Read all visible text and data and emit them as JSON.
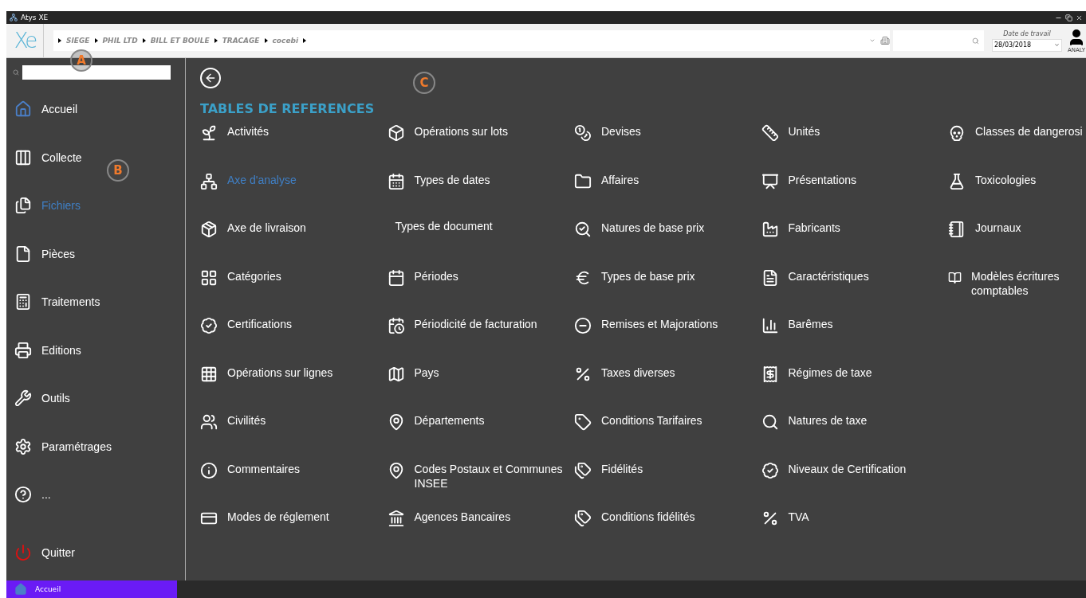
{
  "window": {
    "title": "Atys XE"
  },
  "toolbar": {
    "logo": "Xe",
    "breadcrumbs": [
      "SIEGE",
      "PHIL LTD",
      "BILL ET BOULE",
      "TRACAGE",
      "cocebi"
    ],
    "date_label": "Date de travail",
    "date_value": "28/03/2018",
    "user": "ANALY"
  },
  "sidebar": {
    "items": [
      {
        "label": "Accueil",
        "selected": false
      },
      {
        "label": "Collecte",
        "selected": false
      },
      {
        "label": "Fichiers",
        "selected": true
      },
      {
        "label": "Pièces",
        "selected": false
      },
      {
        "label": "Traitements",
        "selected": false
      },
      {
        "label": "Editions",
        "selected": false
      },
      {
        "label": "Outils",
        "selected": false
      },
      {
        "label": "Paramétrages",
        "selected": false
      },
      {
        "label": "...",
        "selected": false
      },
      {
        "label": "Quitter",
        "selected": false
      }
    ]
  },
  "main": {
    "title": "TABLES DE REFERENCES",
    "items": [
      {
        "label": "Activités",
        "selected": false,
        "kind": "icon"
      },
      {
        "label": "Axe d'analyse",
        "selected": true,
        "kind": "icon"
      },
      {
        "label": "Axe de livraison",
        "selected": false,
        "kind": "icon"
      },
      {
        "label": "Catégories",
        "selected": false,
        "kind": "icon"
      },
      {
        "label": "Certifications",
        "selected": false,
        "kind": "icon"
      },
      {
        "label": "Opérations sur lignes",
        "selected": false,
        "kind": "icon"
      },
      {
        "label": "Civilités",
        "selected": false,
        "kind": "icon"
      },
      {
        "label": "Commentaires",
        "selected": false,
        "kind": "icon"
      },
      {
        "label": "Modes de réglement",
        "selected": false,
        "kind": "icon"
      },
      {
        "label": "Opérations sur lots",
        "selected": false,
        "kind": "icon"
      },
      {
        "label": "Types de dates",
        "selected": false,
        "kind": "icon"
      },
      {
        "label": "Types de document",
        "selected": false,
        "kind": "plain"
      },
      {
        "label": "Périodes",
        "selected": false,
        "kind": "icon"
      },
      {
        "label": "Périodicité de facturation",
        "selected": false,
        "kind": "icon"
      },
      {
        "label": "Pays",
        "selected": false,
        "kind": "icon"
      },
      {
        "label": "Départements",
        "selected": false,
        "kind": "icon"
      },
      {
        "label": "Codes Postaux et Communes INSEE",
        "selected": false,
        "kind": "icon"
      },
      {
        "label": "Agences Bancaires",
        "selected": false,
        "kind": "icon"
      },
      {
        "label": "Devises",
        "selected": false,
        "kind": "icon"
      },
      {
        "label": "Affaires",
        "selected": false,
        "kind": "icon"
      },
      {
        "label": "Natures de base prix",
        "selected": false,
        "kind": "icon"
      },
      {
        "label": "Types de base prix",
        "selected": false,
        "kind": "icon"
      },
      {
        "label": "Remises et Majorations",
        "selected": false,
        "kind": "icon"
      },
      {
        "label": "Taxes diverses",
        "selected": false,
        "kind": "icon"
      },
      {
        "label": "Conditions Tarifaires",
        "selected": false,
        "kind": "icon"
      },
      {
        "label": "Fidélités",
        "selected": false,
        "kind": "icon"
      },
      {
        "label": "Conditions fidélités",
        "selected": false,
        "kind": "icon"
      },
      {
        "label": "Unités",
        "selected": false,
        "kind": "icon"
      },
      {
        "label": "Présentations",
        "selected": false,
        "kind": "icon"
      },
      {
        "label": "Fabricants",
        "selected": false,
        "kind": "icon"
      },
      {
        "label": "Caractéristiques",
        "selected": false,
        "kind": "icon"
      },
      {
        "label": "Barêmes",
        "selected": false,
        "kind": "icon"
      },
      {
        "label": "Régimes de taxe",
        "selected": false,
        "kind": "icon"
      },
      {
        "label": "Natures de taxe",
        "selected": false,
        "kind": "icon"
      },
      {
        "label": "Niveaux de Certification",
        "selected": false,
        "kind": "icon"
      },
      {
        "label": "TVA",
        "selected": false,
        "kind": "icon"
      },
      {
        "label": "Classes de dangerosi",
        "selected": false,
        "kind": "icon"
      },
      {
        "label": "Toxicologies",
        "selected": false,
        "kind": "icon"
      },
      {
        "label": "Journaux",
        "selected": false,
        "kind": "icon"
      },
      {
        "label": "Modèles écritures comptables",
        "selected": false,
        "kind": "icon"
      }
    ]
  },
  "annotations": [
    "A",
    "B",
    "C"
  ],
  "status_bar": {
    "label": "Accueil"
  }
}
